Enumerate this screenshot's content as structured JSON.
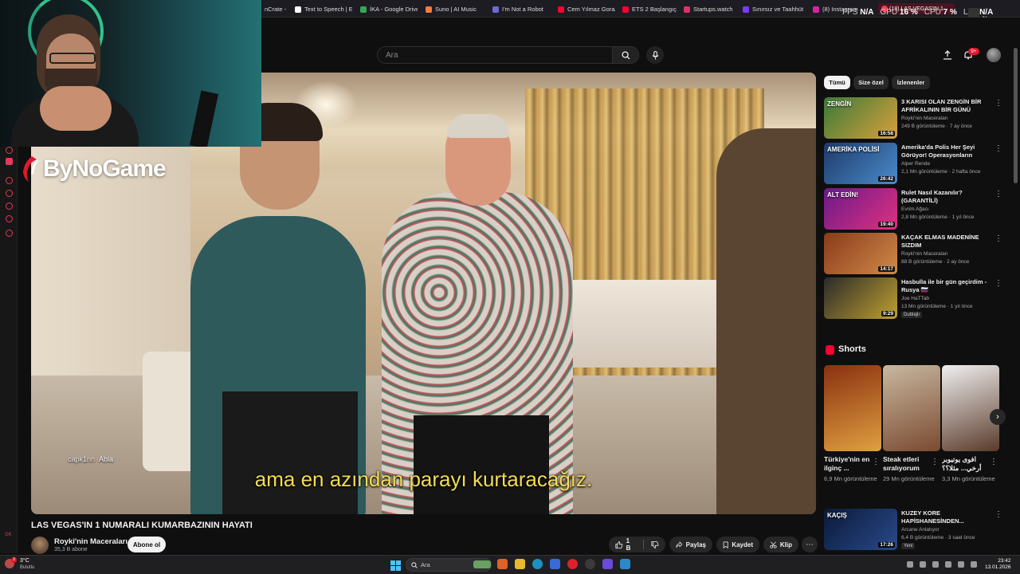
{
  "bookmarks": [
    {
      "label": "nCrate - M",
      "color": "#888888"
    },
    {
      "label": "Text to Speech | Elev",
      "color": "#ffffff"
    },
    {
      "label": "İKA - Google Drive",
      "color": "#34a853"
    },
    {
      "label": "Suno | AI Music",
      "color": "#ff7a3c"
    },
    {
      "label": "I'm Not a Robot",
      "color": "#6b6bd6"
    },
    {
      "label": "Cem Yılmaz Gora/Ar",
      "color": "#ff0033"
    },
    {
      "label": "ETS 2 Başlangıç Reh",
      "color": "#ff0033"
    },
    {
      "label": "Startups.watch",
      "color": "#e0306a"
    },
    {
      "label": "Sınırsız ve Taahhüt",
      "color": "#7a3cff"
    },
    {
      "label": "(8) Instagram",
      "color": "#d6249f"
    }
  ],
  "active_tab": "(18) LAS VEGAS'IN 1",
  "overlay_stats": [
    {
      "label": "FPS",
      "value": "N/A"
    },
    {
      "label": "GPU",
      "value": "16 %"
    },
    {
      "label": "CPU",
      "value": "7 %"
    },
    {
      "label": "LAT",
      "value": "N/A"
    }
  ],
  "tab_controls_text": "AI",
  "search": {
    "placeholder": "Ara"
  },
  "notifications_count": "9+",
  "brand_overlay": {
    "text": "ByNoGame"
  },
  "chat": {
    "user": "capk1nn",
    "message": "Abla"
  },
  "subtitle": "ama en azından parayı kurtaracağız.",
  "video": {
    "title": "LAS VEGAS'IN 1 NUMARALI KUMARBAZININ HAYATI",
    "channel": "Royki'nin Maceraları",
    "subscribers": "35,3 B abone",
    "subscribe_label": "Abone ol",
    "likes": "1 B",
    "share_label": "Paylaş",
    "save_label": "Kaydet",
    "clip_label": "Klip"
  },
  "chips": [
    "Tümü",
    "Size özel",
    "İzlenenler"
  ],
  "recommendations": [
    {
      "title": "3 KARISI OLAN ZENGİN BİR AFRİKALININ BİR GÜNÜ",
      "channel": "Royki'nin Maceraları",
      "meta": "249 B görüntüleme · 7 ay önce",
      "duration": "16:58",
      "thumb_text": "ZENGİN",
      "colors": [
        "#3a7a3a",
        "#d9a03a"
      ]
    },
    {
      "title": "Amerika'da Polis Her Şeyi Görüyor! Operasyonların Perde...",
      "channel": "Alper Rende",
      "meta": "2,1 Mn görüntüleme · 2 hafta önce",
      "duration": "26:42",
      "thumb_text": "AMERİKA POLİSİ",
      "colors": [
        "#1e3a6a",
        "#4a8aca"
      ]
    },
    {
      "title": "Rulet Nasıl Kazanılır? (GARANTİLİ)",
      "channel": "Evrim Ağacı",
      "meta": "2,8 Mn görüntüleme · 1 yıl önce",
      "duration": "19:40",
      "thumb_text": "ALT EDİN!",
      "colors": [
        "#6a1a8a",
        "#e03080"
      ]
    },
    {
      "title": "KAÇAK ELMAS MADENİNE SIZDIM",
      "channel": "Royki'nin Maceraları",
      "meta": "88 B görüntüleme · 2 ay önce",
      "duration": "14:17",
      "thumb_text": "",
      "colors": [
        "#8a3a1a",
        "#d08a4a"
      ]
    },
    {
      "title": "Hasbulla ile bir gün geçirdim - Rusya 🇷🇺",
      "channel": "Joe HaTTab",
      "meta": "13 Mn görüntüleme · 1 yıl önce",
      "duration": "9:29",
      "thumb_text": "",
      "colors": [
        "#2a2a2a",
        "#c0a030"
      ],
      "badge": "Dublajlı"
    },
    {
      "title": "KUZEY KORE HAPİSHANESİNDEN...",
      "channel": "Arcane Anlatıyor",
      "meta": "6,4 B görüntüleme · 3 saat önce",
      "duration": "17:26",
      "thumb_text": "KAÇIŞ",
      "colors": [
        "#0a1a3a",
        "#2a4a8a"
      ],
      "badge": "Yeni"
    }
  ],
  "shorts": {
    "title": "Shorts",
    "items": [
      {
        "title": "Türkiye'nin en ilginç ...",
        "views": "6,9 Mn görüntüleme",
        "colors": [
          "#8a3010",
          "#e0a040"
        ]
      },
      {
        "title": "Steak etleri sıralıyorum",
        "views": "29 Mn görüntüleme",
        "colors": [
          "#c8b8a0",
          "#7a4a30"
        ]
      },
      {
        "title": "افوى يوتيوبر أرخي... مثلا؟؟",
        "views": "3,3 Mn görüntüleme",
        "colors": [
          "#f0f0f0",
          "#5a3a2a"
        ]
      }
    ]
  },
  "taskbar": {
    "weather_temp": "3°C",
    "weather_desc": "Bulutlu",
    "weather_alerts": "3",
    "search_placeholder": "Ara",
    "time": "23:42",
    "date": "13.01.2026"
  },
  "dock_bottom_label": "GK"
}
